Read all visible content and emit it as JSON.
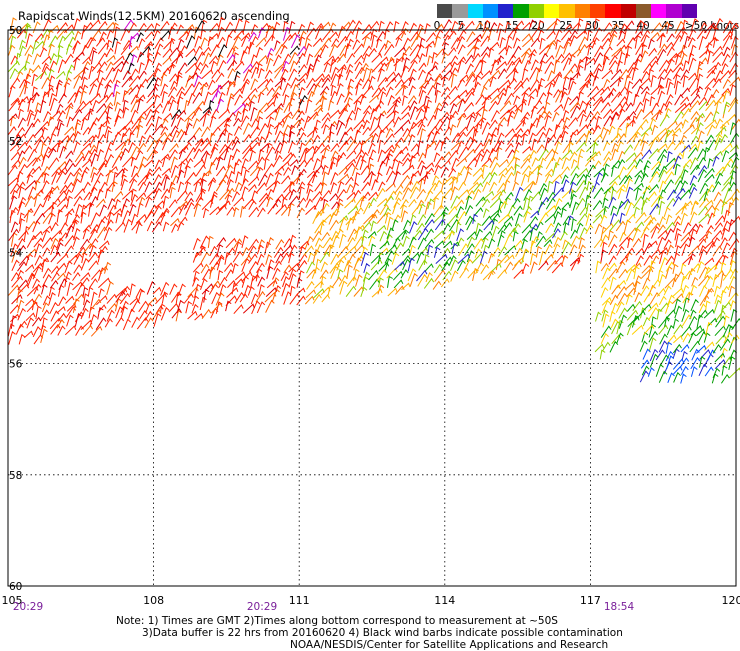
{
  "title": "Rapidscat Winds(12.5KM) 20160620 ascending",
  "legend": {
    "labels": [
      "0",
      "5",
      "10",
      "15",
      "20",
      "25",
      "30",
      "35",
      "40",
      "45",
      ">50 knots"
    ],
    "colors": [
      "#4a4a4a",
      "#9a9a9a",
      "#00d8ff",
      "#0090ff",
      "#2222cc",
      "#00a000",
      "#90d000",
      "#ffff00",
      "#ffc000",
      "#ff8000",
      "#ff4000",
      "#ff0000",
      "#c00000",
      "#8b5a2b",
      "#ff00ff",
      "#b000d0",
      "#6000b0"
    ]
  },
  "map": {
    "lon_ticks": [
      "105",
      "108",
      "111",
      "114",
      "117",
      "120"
    ],
    "lat_ticks": [
      "-50",
      "-52",
      "-54",
      "-56",
      "-58",
      "-60"
    ],
    "lat_labels": [
      "50",
      "52",
      "54",
      "56",
      "58",
      "60"
    ],
    "lon_range": [
      105,
      120
    ],
    "lat_range": [
      -60,
      -50
    ],
    "grid": true
  },
  "times": [
    "20:29",
    "20:29",
    "18:54"
  ],
  "notes": [
    "Note: 1) Times are GMT 2)Times along bottom correspond to measurement at ~50S",
    "3)Data buffer is 22 hrs from 20160620 4) Black wind barbs indicate possible contamination",
    "NOAA/NESDIS/Center for Satellite Applications and Research"
  ]
}
